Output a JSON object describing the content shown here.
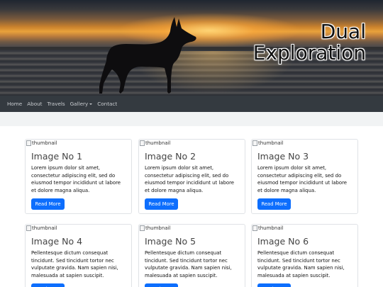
{
  "header": {
    "title_line1": "Dual",
    "title_line2": "Exploration"
  },
  "nav": {
    "items": [
      "Home",
      "About",
      "Travels",
      "Gallery",
      "Contact"
    ]
  },
  "thumbnail_alt": "thumbnail",
  "read_more_label": "Read More",
  "cards": [
    {
      "title": "Image No 1",
      "text": "Lorem ipsum dolor sit amet, consectetur adipiscing elit, sed do eiusmod tempor incididunt ut labore et dolore magna aliqua."
    },
    {
      "title": "Image No 2",
      "text": "Lorem ipsum dolor sit amet, consectetur adipiscing elit, sed do eiusmod tempor incididunt ut labore et dolore magna aliqua."
    },
    {
      "title": "Image No 3",
      "text": "Lorem ipsum dolor sit amet, consectetur adipiscing elit, sed do eiusmod tempor incididunt ut labore et dolore magna aliqua."
    },
    {
      "title": "Image No 4",
      "text": "Pellentesque dictum consequat tincidunt. Sed tincidunt tortor nec vulputate gravida. Nam sapien nisi, malesuada at sapien suscipit."
    },
    {
      "title": "Image No 5",
      "text": "Pellentesque dictum consequat tincidunt. Sed tincidunt tortor nec vulputate gravida. Nam sapien nisi, malesuada at sapien suscipit."
    },
    {
      "title": "Image No 6",
      "text": "Pellentesque dictum consequat tincidunt. Sed tincidunt tortor nec vulputate gravida. Nam sapien nisi, malesuada at sapien suscipit."
    }
  ]
}
